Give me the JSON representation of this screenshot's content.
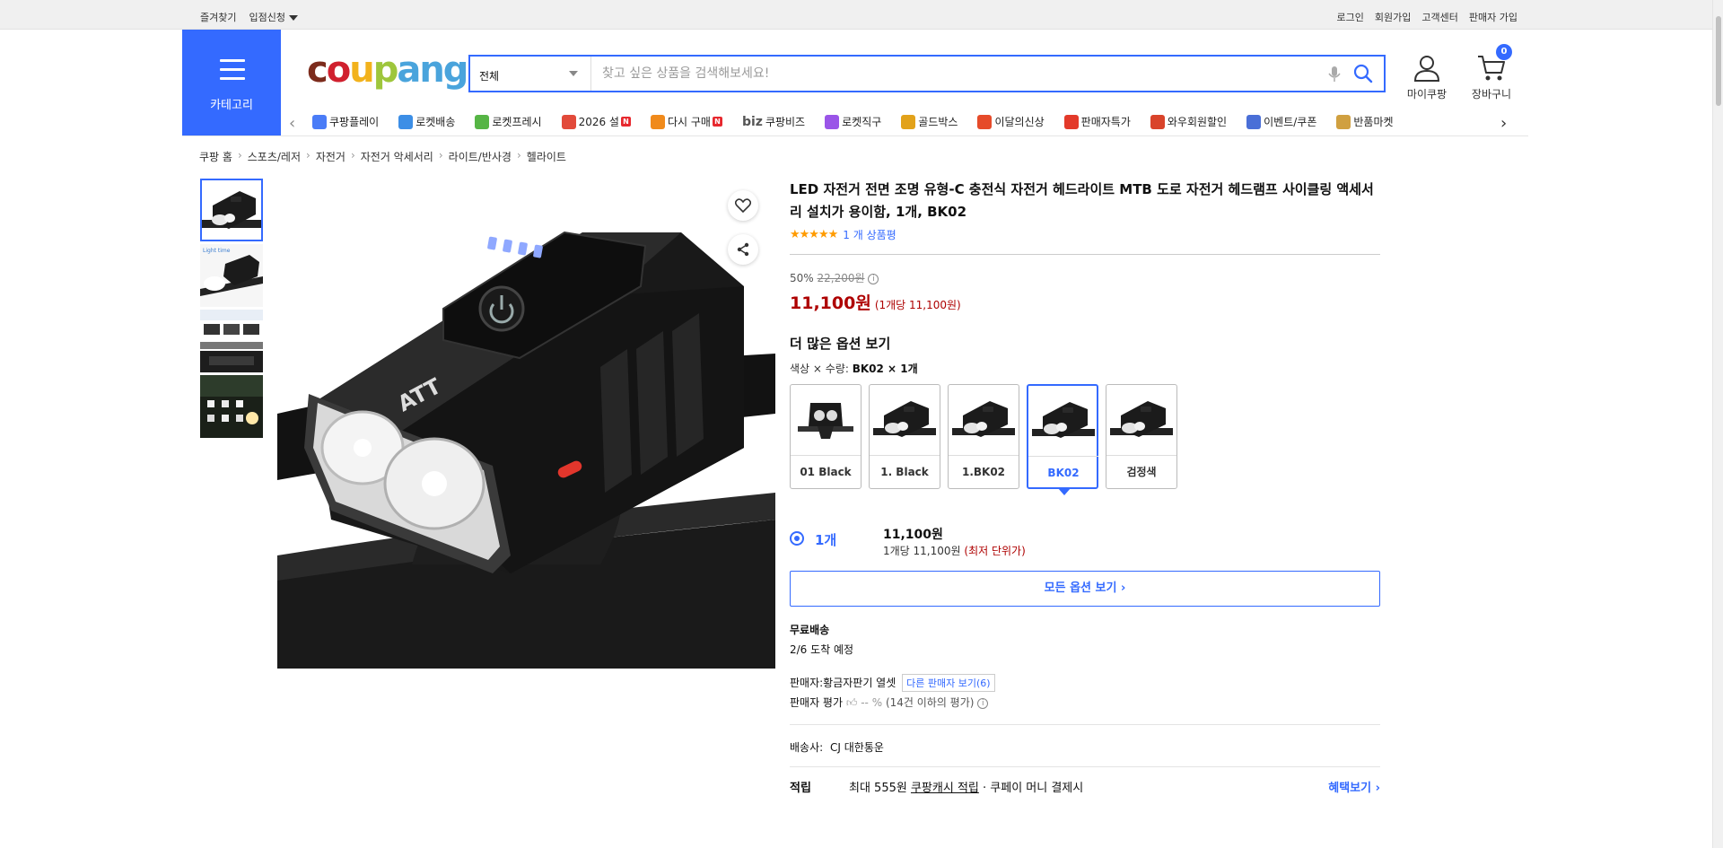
{
  "topbar": {
    "left": [
      "즐겨찾기",
      "입점신청"
    ],
    "right": [
      "로그인",
      "회원가입",
      "고객센터",
      "판매자 가입"
    ]
  },
  "header": {
    "category_label": "카테고리",
    "logo": [
      "c",
      "o",
      "u",
      "p",
      "ang"
    ],
    "search_scope": "전체",
    "search_placeholder": "찾고 싶은 상품을 검색해보세요!",
    "mypage": "마이쿠팡",
    "cart": "장바구니",
    "cart_count": "0"
  },
  "ribbon": [
    {
      "label": "쿠팡플레이",
      "color": "#4a7cf7"
    },
    {
      "label": "로켓배송",
      "color": "#3c8ee6"
    },
    {
      "label": "로켓프레시",
      "color": "#56b545"
    },
    {
      "label": "2026 설",
      "color": "#e24a3a",
      "new": "N"
    },
    {
      "label": "다시 구매",
      "color": "#f08a1b",
      "new": "N"
    },
    {
      "label": "쿠팡비즈",
      "color": "#555555",
      "prefix": "biz"
    },
    {
      "label": "로켓직구",
      "color": "#9a55e8"
    },
    {
      "label": "골드박스",
      "color": "#e2a21a"
    },
    {
      "label": "이달의신상",
      "color": "#e64b2a"
    },
    {
      "label": "판매자특가",
      "color": "#e33a2a"
    },
    {
      "label": "와우회원할인",
      "color": "#d9432a"
    },
    {
      "label": "이벤트/쿠폰",
      "color": "#4a6fd7"
    },
    {
      "label": "반품마켓",
      "color": "#d0a040"
    }
  ],
  "breadcrumb": [
    "쿠팡 홈",
    "스포츠/레저",
    "자전거",
    "자전거 악세서리",
    "라이트/반사경",
    "헬라이트"
  ],
  "product": {
    "title": "LED 자전거 전면 조명 유형-C 충전식 자전거 헤드라이트 MTB 도로 자전거 헤드램프 사이클링 액세서리 설치가 용이함, 1개, BK02",
    "stars": "★★★★★",
    "review_count": "1 개 상품평",
    "discount_rate": "50%",
    "original_price": "22,200원",
    "price": "11,100원",
    "unit_price": "(1개당 11,100원)",
    "more_options": "더 많은 옵션 보기",
    "option_prefix": "색상 × 수량: ",
    "option_value": "BK02 × 1개",
    "swatches": [
      "01 Black",
      "1. Black",
      "1.BK02",
      "BK02",
      "검정색"
    ],
    "selected_swatch": 3,
    "qty_label": "1개",
    "qty_price": "11,100원",
    "qty_unit": "1개당 11,100원",
    "qty_lowest": "(최저 단위가)",
    "all_options": "모든 옵션 보기 ›",
    "shipping_title": "무료배송",
    "shipping_date": "2/6 도착 예정",
    "seller_label": "판매자:",
    "seller_name": "황금자판기 열셋",
    "other_sellers": "다른 판매자 보기(6)",
    "seller_rating_label": "판매자 평가",
    "seller_rating_value": "-- %",
    "seller_rating_note": "(14건 이하의 평가)",
    "courier_label": "배송사:",
    "courier_name": "CJ 대한통운",
    "reward_label": "적립",
    "reward_text_a": "최대 555원 ",
    "reward_text_b": "쿠팡캐시 적립",
    "reward_text_c": " · 쿠페이 머니 결제시",
    "reward_more": "혜택보기 ›"
  },
  "colors": {
    "accent": "#346aff",
    "price": "#ae0000",
    "star": "#ff9b00"
  }
}
